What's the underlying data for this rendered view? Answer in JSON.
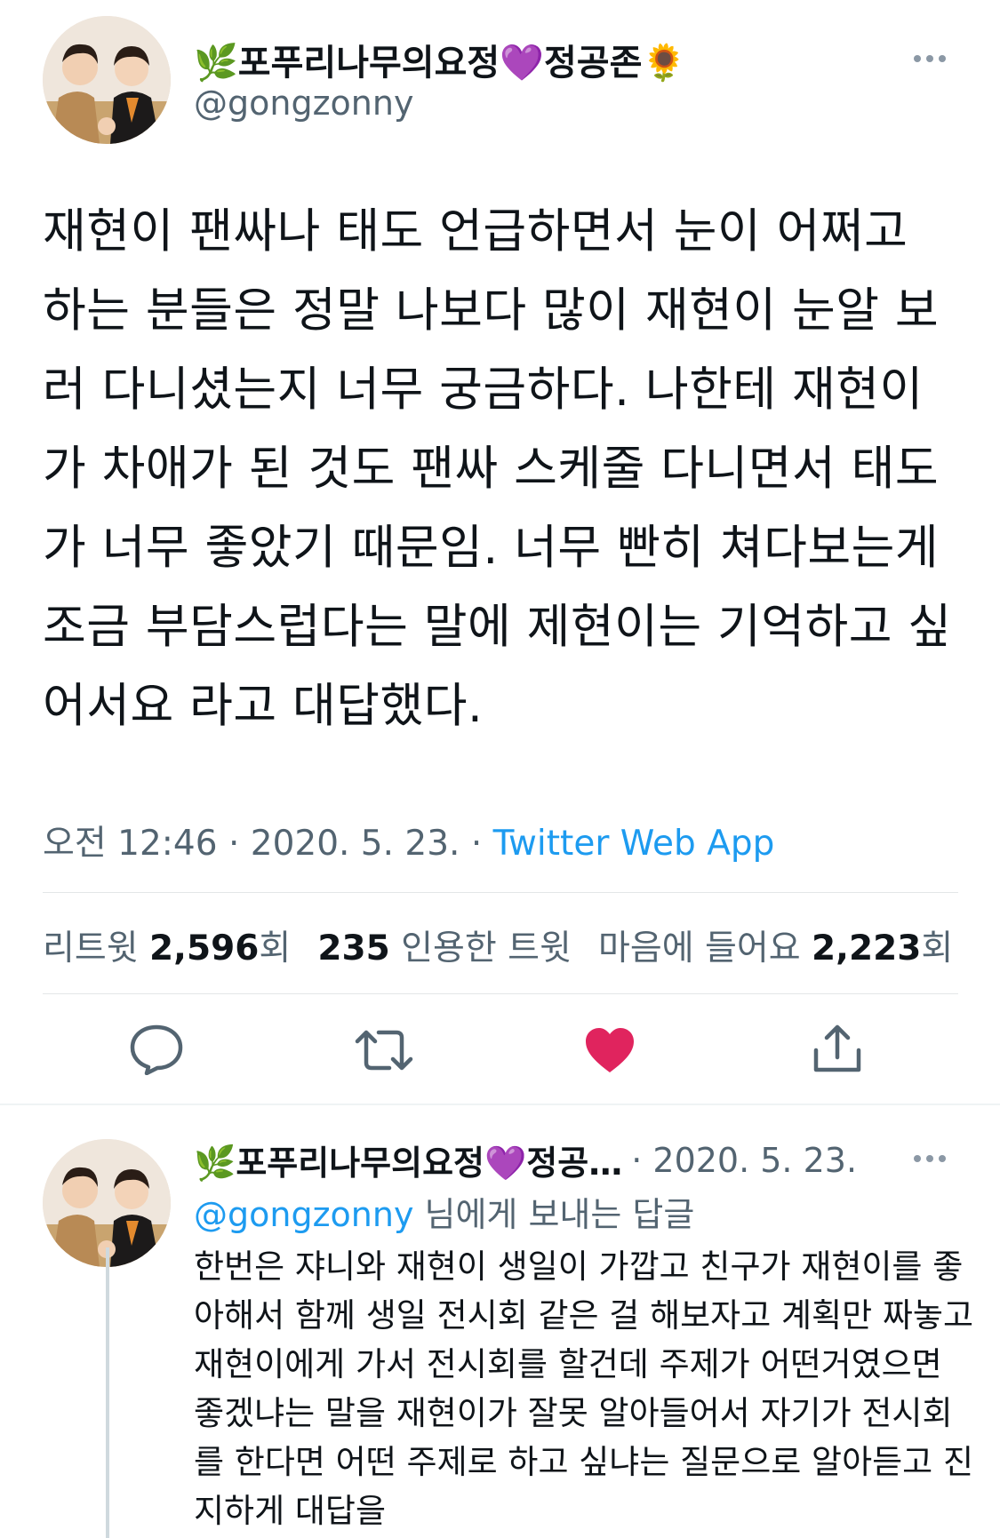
{
  "tweet": {
    "display_name": "🌿포푸리나무의요정💜정공존🌻",
    "handle": "@gongzonny",
    "text": "재현이 팬싸나 태도 언급하면서 눈이 어쩌고 하는 분들은 정말 나보다 많이 재현이 눈알 보러 다니셨는지 너무 궁금하다. 나한테 재현이가 차애가 된 것도 팬싸 스케줄 다니면서 태도가 너무 좋았기 때문임. 너무 빤히 쳐다보는게 조금 부담스럽다는 말에 제현이는 기억하고 싶어서요 라고 대답했다.",
    "time": "오전 12:46",
    "separator": " · ",
    "date": "2020. 5. 23.",
    "source": "Twitter Web App"
  },
  "stats": {
    "retweets_label": "리트윗",
    "retweets_count": "2,596",
    "retweets_suffix": "회",
    "quotes_count": "235",
    "quotes_label": "인용한 트윗",
    "likes_label": "마음에 들어요",
    "likes_count": "2,223",
    "likes_suffix": "회"
  },
  "actions": {
    "icons": [
      "reply-icon",
      "retweet-icon",
      "like-icon",
      "share-icon"
    ],
    "like_color": "#e0245e"
  },
  "reply": {
    "display_name": "🌿포푸리나무의요정💜정공…",
    "date": "· 2020. 5. 23.",
    "replying_to_handle": "@gongzonny",
    "replying_to_suffix": " 님에게 보내는 답글",
    "text": "한번은 쟈니와 재현이 생일이 가깝고 친구가 재현이를 좋아해서 함께 생일 전시회 같은 걸 해보자고 계획만 짜놓고 재현이에게 가서 전시회를 할건데 주제가 어떤거였으면 좋겠냐는 말을 재현이가 잘못 알아들어서 자기가 전시회를 한다면 어떤 주제로 하고 싶냐는 질문으로 알아듣고 진지하게 대답을"
  },
  "colors": {
    "link": "#1d9bf0",
    "muted": "#536471",
    "text": "#0f1419"
  }
}
